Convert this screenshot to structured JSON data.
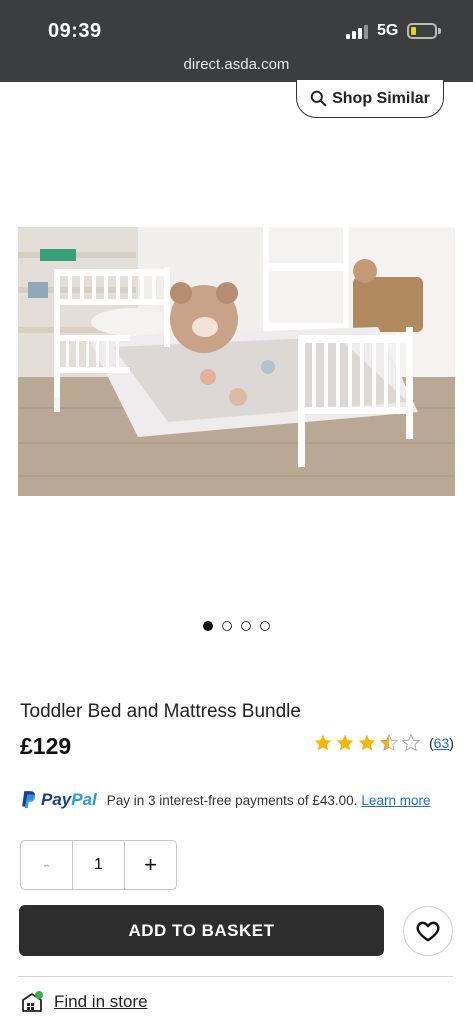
{
  "status_bar": {
    "time": "09:39",
    "network": "5G",
    "url": "direct.asda.com"
  },
  "shop_similar": {
    "label": "Shop Similar",
    "icon": "search-icon"
  },
  "product_image": {
    "alt": "White toddler bed with bear pillow"
  },
  "carousel": {
    "total": 4,
    "active_index": 0
  },
  "product": {
    "title": "Toddler Bed and Mattress Bundle",
    "price": "£129",
    "rating": 3.5,
    "rating_max": 5,
    "review_count": "63"
  },
  "paypal": {
    "brand_pay": "Pay",
    "brand_pal": "Pal",
    "text": "Pay in 3 interest-free payments of £43.00.",
    "link": "Learn more"
  },
  "quantity": {
    "minus": "-",
    "value": "1",
    "plus": "+"
  },
  "add_to_basket": {
    "label": "ADD TO BASKET"
  },
  "find_in_store": {
    "label": "Find in store"
  },
  "colors": {
    "status_bar": "#3b3d3f",
    "button_dark": "#2d2d2d",
    "star": "#f5b700",
    "link": "#1a6fd4",
    "paypal_dark": "#1c3d8f",
    "paypal_light": "#2a9adf",
    "store_badge": "#3fae49"
  }
}
